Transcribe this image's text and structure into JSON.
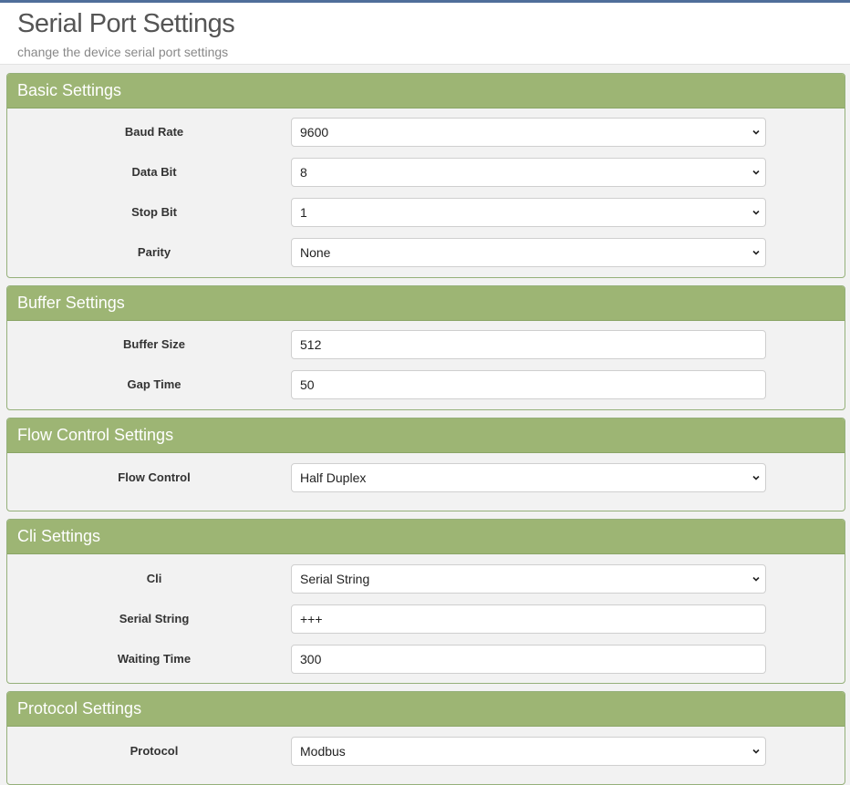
{
  "header": {
    "title": "Serial Port Settings",
    "subtitle": "change the device serial port settings"
  },
  "colors": {
    "panel_header": "#9db574",
    "panel_border": "#95b07a",
    "top_accent": "#4f6e9a"
  },
  "basic": {
    "title": "Basic Settings",
    "baud_rate": {
      "label": "Baud Rate",
      "value": "9600"
    },
    "data_bit": {
      "label": "Data Bit",
      "value": "8"
    },
    "stop_bit": {
      "label": "Stop Bit",
      "value": "1"
    },
    "parity": {
      "label": "Parity",
      "value": "None"
    }
  },
  "buffer": {
    "title": "Buffer Settings",
    "buffer_size": {
      "label": "Buffer Size",
      "value": "512"
    },
    "gap_time": {
      "label": "Gap Time",
      "value": "50"
    }
  },
  "flow": {
    "title": "Flow Control Settings",
    "flow_control": {
      "label": "Flow Control",
      "value": "Half Duplex"
    }
  },
  "cli": {
    "title": "Cli Settings",
    "cli": {
      "label": "Cli",
      "value": "Serial String"
    },
    "serial_string": {
      "label": "Serial String",
      "value": "+++"
    },
    "waiting_time": {
      "label": "Waiting Time",
      "value": "300"
    }
  },
  "protocol": {
    "title": "Protocol Settings",
    "protocol": {
      "label": "Protocol",
      "value": "Modbus"
    }
  },
  "icons": {
    "select_arrow": "chevron-down-icon"
  }
}
